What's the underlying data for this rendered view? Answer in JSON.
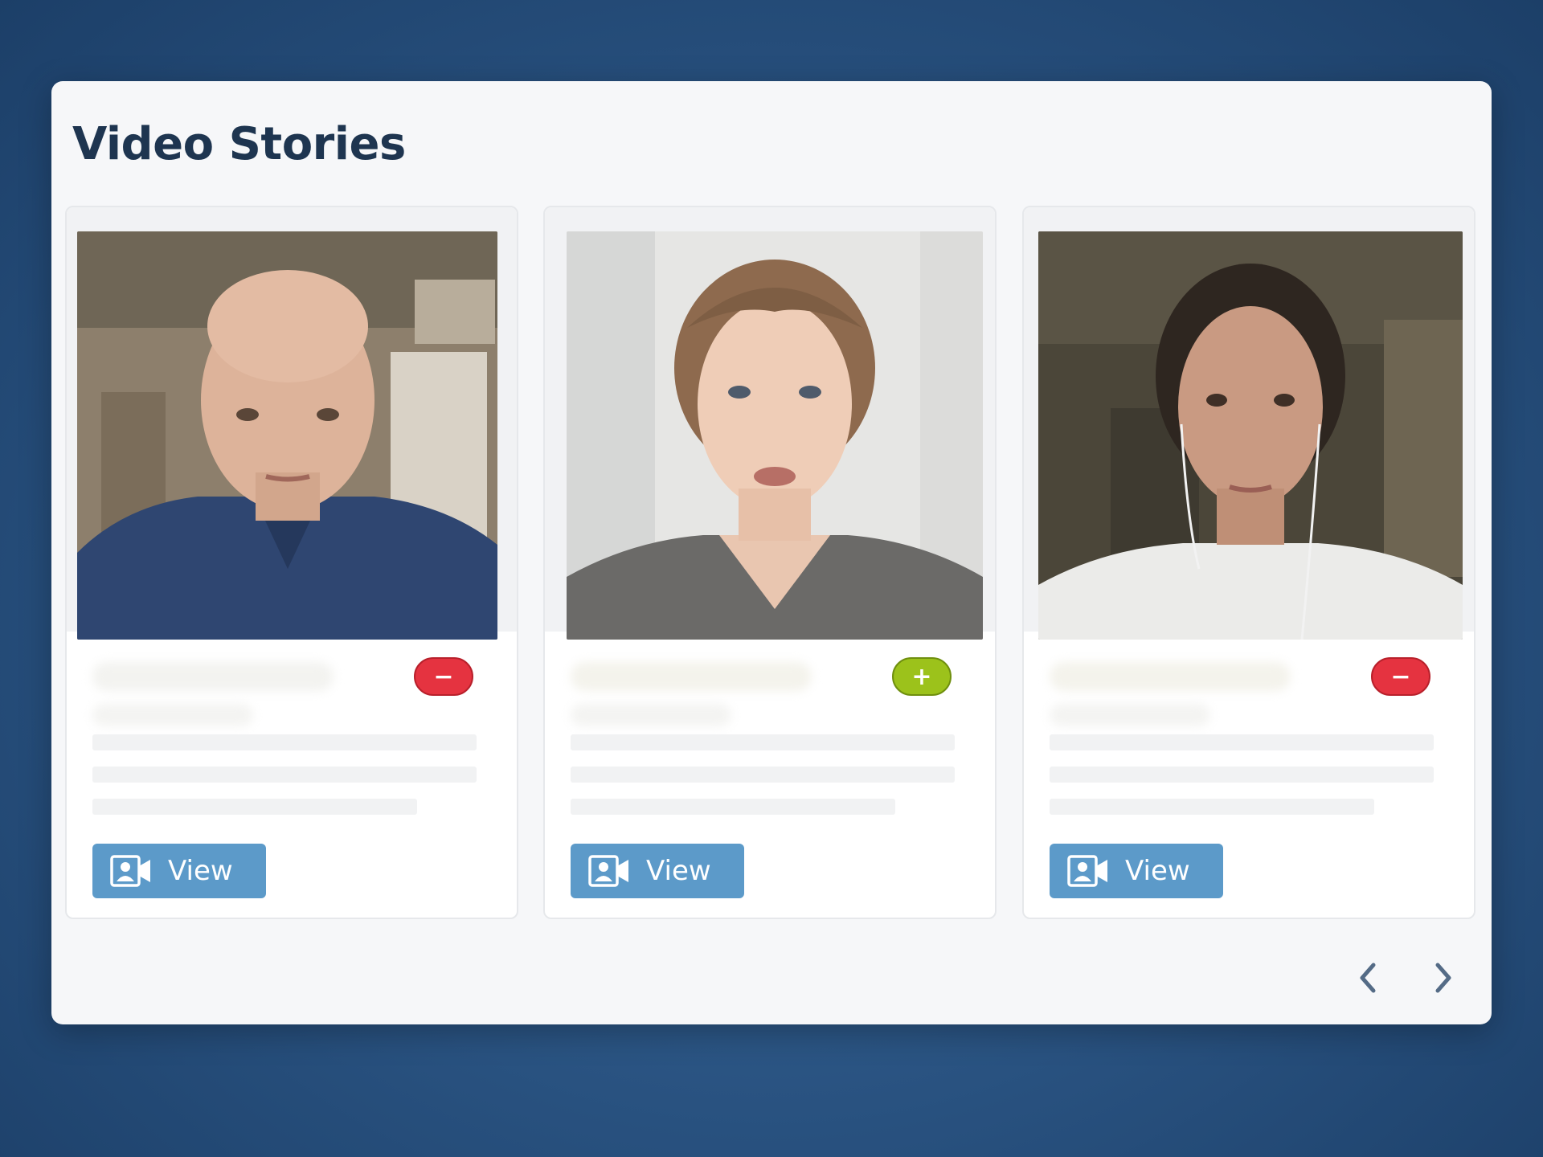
{
  "page": {
    "title": "Video Stories"
  },
  "cards": [
    {
      "action": "−",
      "action_type": "remove",
      "button_label": "View"
    },
    {
      "action": "+",
      "action_type": "add",
      "button_label": "View"
    },
    {
      "action": "−",
      "action_type": "remove",
      "button_label": "View"
    }
  ],
  "icons": {
    "view": "video-camera-contact-icon",
    "prev": "chevron-left-icon",
    "next": "chevron-right-icon"
  },
  "colors": {
    "background": "#2b5584",
    "title": "#1e3550",
    "button": "#5c9ac9",
    "remove_badge": "#e53340",
    "add_badge": "#9cc21b"
  }
}
